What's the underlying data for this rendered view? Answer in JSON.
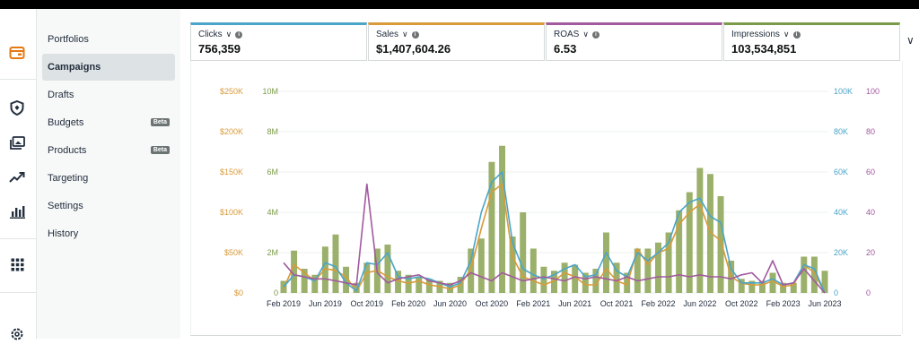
{
  "nav": {
    "items": [
      {
        "label": "Portfolios",
        "active": false,
        "badge": ""
      },
      {
        "label": "Campaigns",
        "active": true,
        "badge": ""
      },
      {
        "label": "Drafts",
        "active": false,
        "badge": ""
      },
      {
        "label": "Budgets",
        "active": false,
        "badge": "Beta"
      },
      {
        "label": "Products",
        "active": false,
        "badge": "Beta"
      },
      {
        "label": "Targeting",
        "active": false,
        "badge": ""
      },
      {
        "label": "Settings",
        "active": false,
        "badge": ""
      },
      {
        "label": "History",
        "active": false,
        "badge": ""
      }
    ]
  },
  "rail_icons": [
    "campaign-manager-icon",
    "shield-icon",
    "media-icon",
    "trend-icon",
    "bar-chart-icon",
    "apps-grid-icon",
    "settings-icon"
  ],
  "metrics": [
    {
      "label": "Clicks",
      "value": "756,359",
      "color": "#4aa5c8"
    },
    {
      "label": "Sales",
      "value": "$1,407,604.26",
      "color": "#d99a3a"
    },
    {
      "label": "ROAS",
      "value": "6.53",
      "color": "#a15a9e"
    },
    {
      "label": "Impressions",
      "value": "103,534,851",
      "color": "#7b9a4a"
    }
  ],
  "chart_data": {
    "type": "bar",
    "x": [
      "Feb 2019",
      "Mar 2019",
      "Apr 2019",
      "May 2019",
      "Jun 2019",
      "Jul 2019",
      "Aug 2019",
      "Sep 2019",
      "Oct 2019",
      "Nov 2019",
      "Dec 2019",
      "Jan 2020",
      "Feb 2020",
      "Mar 2020",
      "Apr 2020",
      "May 2020",
      "Jun 2020",
      "Jul 2020",
      "Aug 2020",
      "Sep 2020",
      "Oct 2020",
      "Nov 2020",
      "Dec 2020",
      "Jan 2021",
      "Feb 2021",
      "Mar 2021",
      "Apr 2021",
      "May 2021",
      "Jun 2021",
      "Jul 2021",
      "Aug 2021",
      "Sep 2021",
      "Oct 2021",
      "Nov 2021",
      "Dec 2021",
      "Jan 2022",
      "Feb 2022",
      "Mar 2022",
      "Apr 2022",
      "May 2022",
      "Jun 2022",
      "Jul 2022",
      "Aug 2022",
      "Sep 2022",
      "Oct 2022",
      "Nov 2022",
      "Dec 2022",
      "Jan 2023",
      "Feb 2023",
      "Mar 2023",
      "Apr 2023",
      "May 2023",
      "Jun 2023"
    ],
    "xtick_labels": [
      "Feb 2019",
      "Jun 2019",
      "Oct 2019",
      "Feb 2020",
      "Jun 2020",
      "Oct 2020",
      "Feb 2021",
      "Jun 2021",
      "Oct 2021",
      "Feb 2022",
      "Jun 2022",
      "Oct 2022",
      "Feb 2023",
      "Jun 2023"
    ],
    "axes": [
      {
        "name": "Sales",
        "ticks": [
          "$0",
          "$50K",
          "$100K",
          "$150K",
          "$200K",
          "$250K"
        ],
        "range": [
          0,
          250000
        ],
        "color": "#d99a3a",
        "side": "left-outer"
      },
      {
        "name": "Impressions",
        "ticks": [
          "0",
          "2M",
          "4M",
          "6M",
          "8M",
          "10M"
        ],
        "range": [
          0,
          10000000
        ],
        "color": "#7b9a4a",
        "side": "left-inner"
      },
      {
        "name": "Clicks",
        "ticks": [
          "0",
          "20K",
          "40K",
          "60K",
          "80K",
          "100K"
        ],
        "range": [
          0,
          100000
        ],
        "color": "#4aa5c8",
        "side": "right-inner"
      },
      {
        "name": "ROAS",
        "ticks": [
          "0",
          "20",
          "40",
          "60",
          "80",
          "100"
        ],
        "range": [
          0,
          100
        ],
        "color": "#a15a9e",
        "side": "right-outer"
      }
    ],
    "series": [
      {
        "name": "Impressions",
        "kind": "bar",
        "axis": 1,
        "color": "#9bb06a",
        "values": [
          600000,
          2100000,
          1200000,
          900000,
          2300000,
          2900000,
          1300000,
          500000,
          1500000,
          2200000,
          2400000,
          1100000,
          900000,
          800000,
          700000,
          600000,
          500000,
          800000,
          2200000,
          2700000,
          6500000,
          7300000,
          2800000,
          4000000,
          2200000,
          1300000,
          1100000,
          1500000,
          1400000,
          1000000,
          1200000,
          3000000,
          1500000,
          1000000,
          2200000,
          2200000,
          2500000,
          3000000,
          4100000,
          5000000,
          6200000,
          5900000,
          4800000,
          1600000,
          700000,
          600000,
          600000,
          1000000,
          500000,
          500000,
          1800000,
          1800000,
          1100000
        ]
      },
      {
        "name": "Sales",
        "kind": "line",
        "axis": 0,
        "color": "#d99a3a",
        "values": [
          5000,
          35000,
          25000,
          15000,
          30000,
          28000,
          20000,
          2000,
          25000,
          28000,
          20000,
          15000,
          12000,
          15000,
          10000,
          8000,
          5000,
          10000,
          30000,
          80000,
          125000,
          135000,
          45000,
          20000,
          15000,
          10000,
          15000,
          25000,
          20000,
          10000,
          10000,
          30000,
          15000,
          10000,
          55000,
          35000,
          50000,
          55000,
          85000,
          100000,
          110000,
          75000,
          65000,
          20000,
          12000,
          10000,
          10000,
          15000,
          8000,
          10000,
          35000,
          25000,
          0
        ]
      },
      {
        "name": "Clicks",
        "kind": "line",
        "axis": 2,
        "color": "#4aa5c8",
        "values": [
          3000,
          9000,
          8000,
          6000,
          15000,
          13000,
          5000,
          1000,
          15000,
          14000,
          20000,
          8000,
          7000,
          8000,
          7000,
          5000,
          3000,
          5000,
          16000,
          40000,
          55000,
          60000,
          25000,
          12000,
          9000,
          7000,
          9000,
          12000,
          14000,
          8000,
          9000,
          20000,
          11000,
          8000,
          20000,
          16000,
          20000,
          25000,
          40000,
          45000,
          47000,
          38000,
          35000,
          12000,
          5000,
          5000,
          5000,
          7000,
          4000,
          5000,
          14000,
          12000,
          0
        ]
      },
      {
        "name": "ROAS",
        "kind": "line",
        "axis": 3,
        "color": "#a15a9e",
        "values": [
          15,
          9,
          8,
          7,
          7,
          6,
          5,
          4,
          54,
          10,
          5,
          7,
          8,
          9,
          6,
          5,
          4,
          6,
          10,
          8,
          6,
          10,
          8,
          6,
          7,
          8,
          7,
          6,
          8,
          7,
          8,
          7,
          6,
          8,
          6,
          7,
          8,
          8,
          9,
          8,
          9,
          8,
          8,
          7,
          9,
          10,
          5,
          16,
          4,
          5,
          12,
          6,
          0
        ]
      }
    ]
  }
}
